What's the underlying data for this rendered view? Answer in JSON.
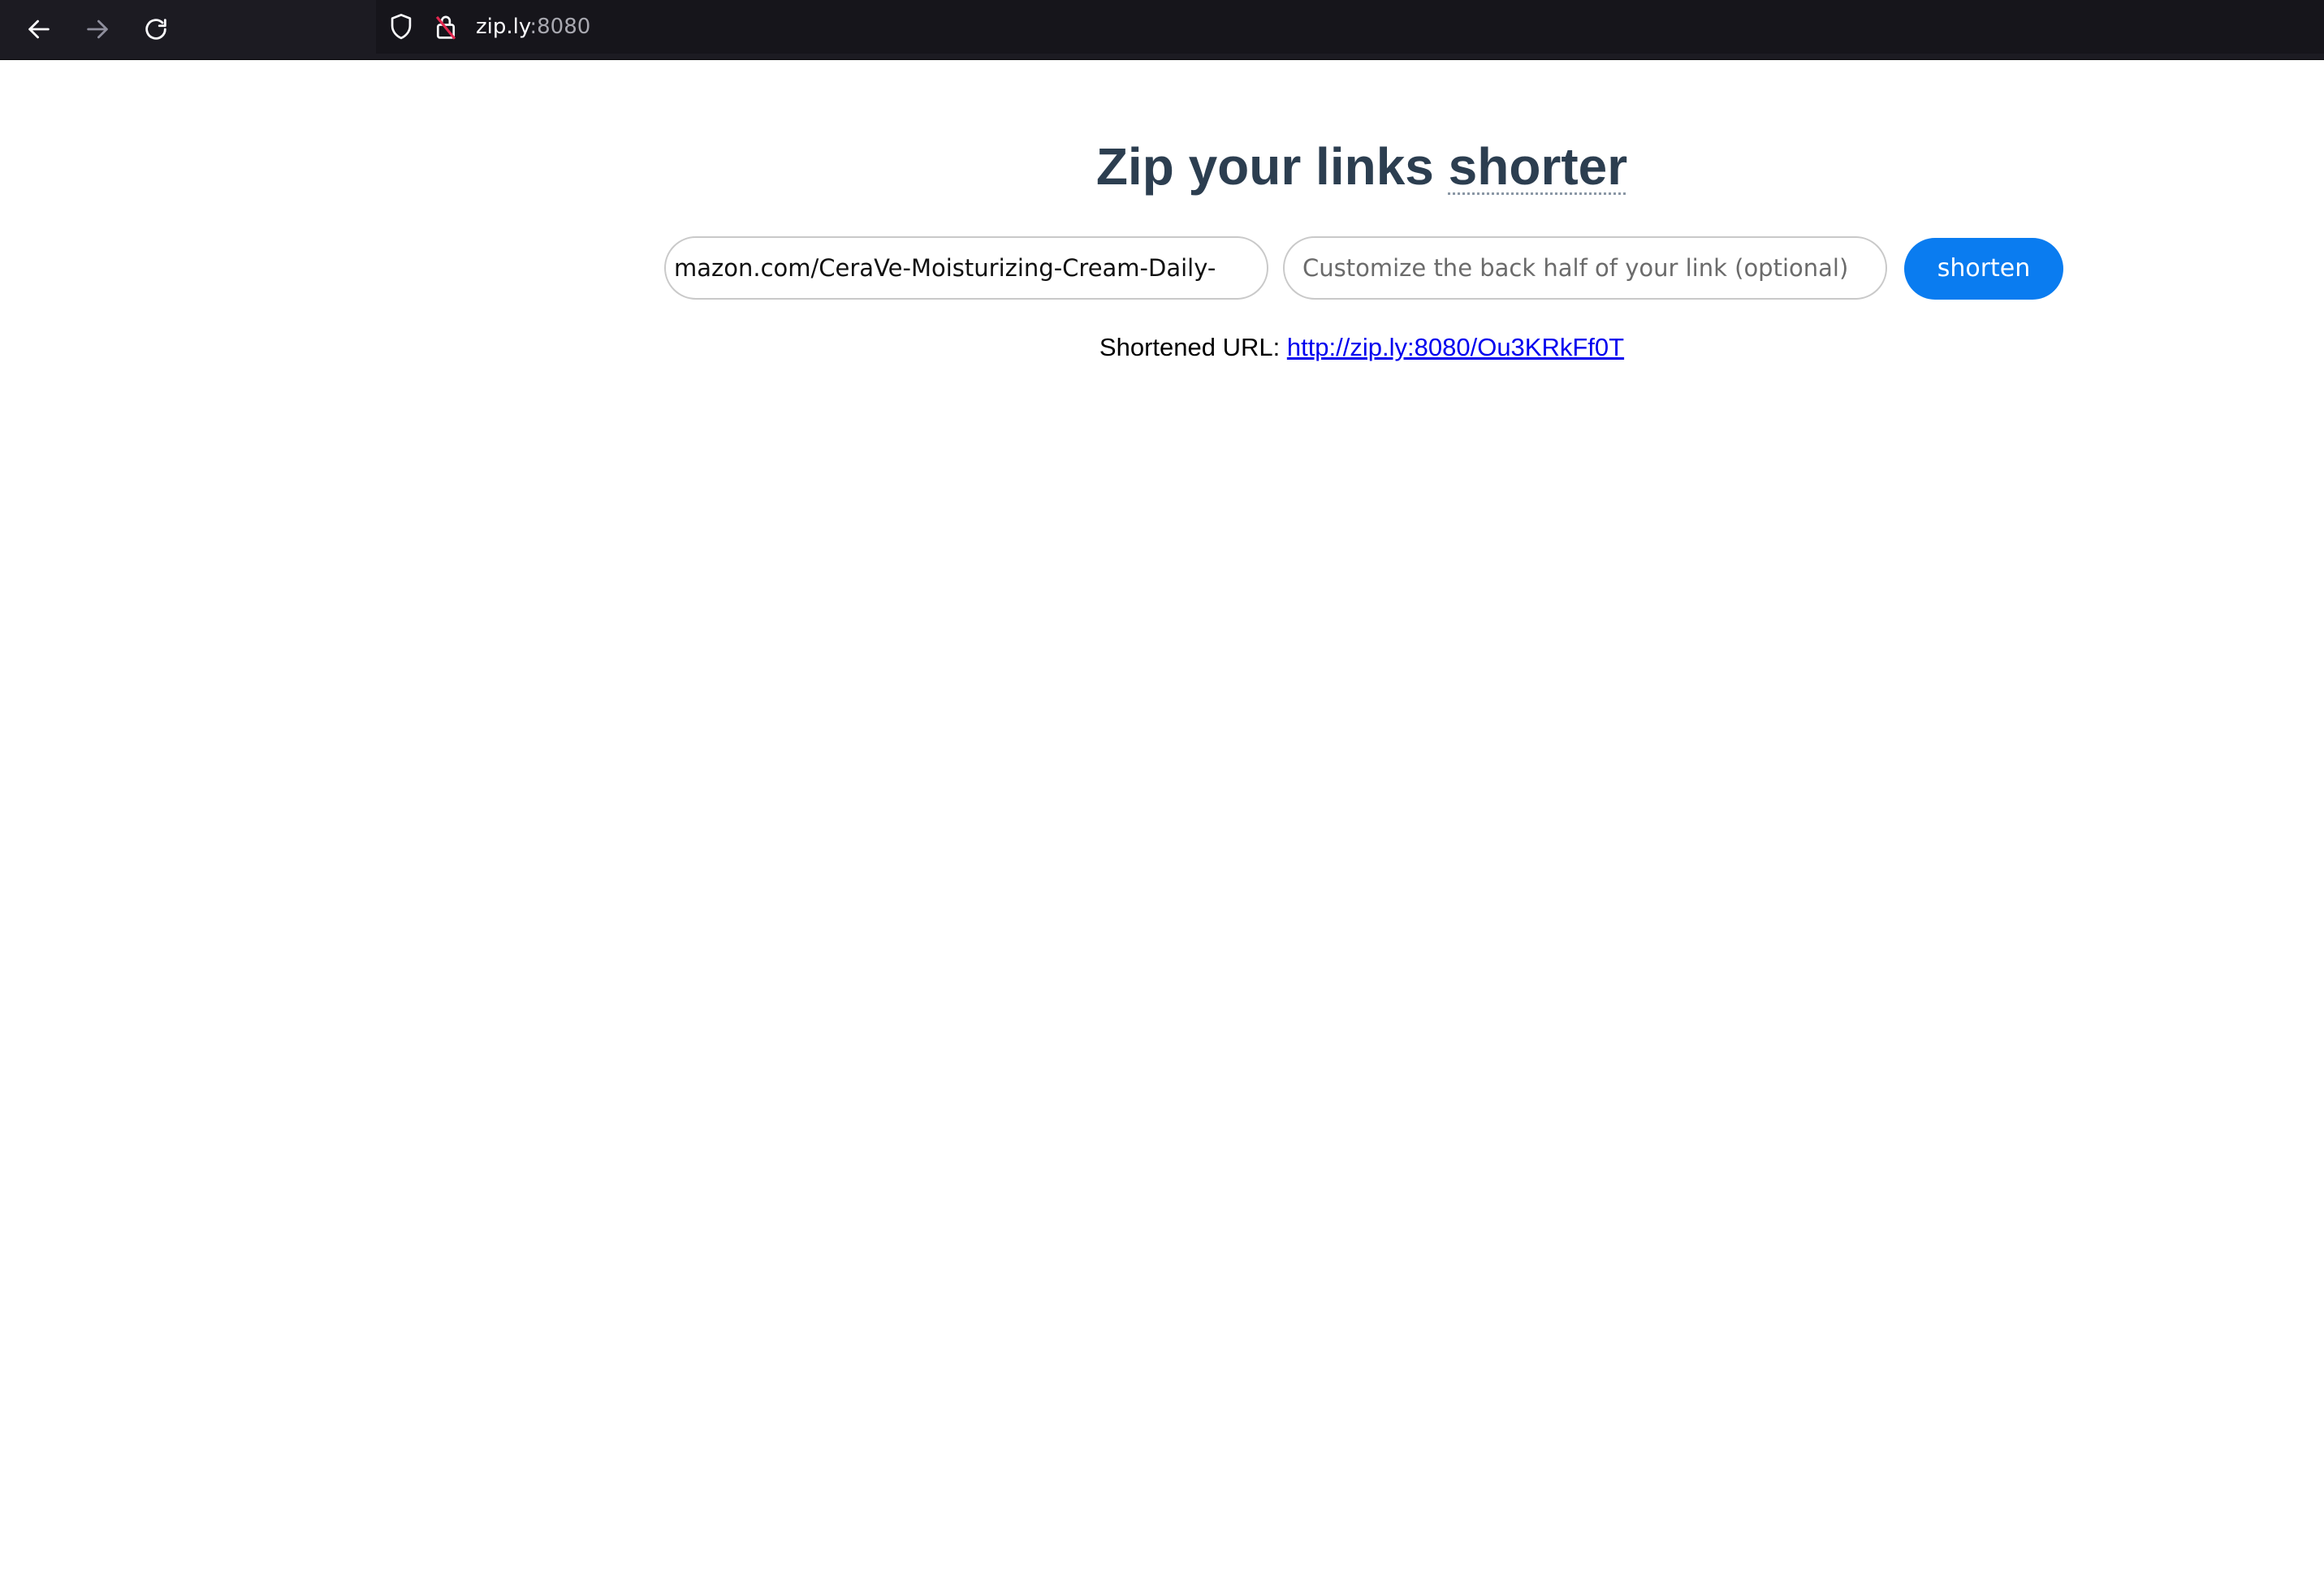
{
  "browser": {
    "back_icon": "arrow-left-icon",
    "forward_icon": "arrow-right-icon",
    "reload_icon": "reload-icon",
    "shield_icon": "shield-icon",
    "insecure_lock_icon": "insecure-lock-icon",
    "url_host": "zip.ly",
    "url_port": ":8080"
  },
  "page": {
    "title_main": "Zip your links",
    "title_accent": "shorter",
    "url_input_value": "mazon.com/CeraVe-Moisturizing-Cream-Daily-",
    "custom_input_placeholder": "Customize the back half of your link (optional)",
    "shorten_label": "shorten",
    "result_label": "Shortened URL:",
    "result_link": "http://zip.ly:8080/Ou3KRkFf0T"
  },
  "colors": {
    "toolbar_bg": "#1c1b22",
    "title": "#2c3e50",
    "button": "#0a7cf0",
    "link": "#0000ee"
  }
}
